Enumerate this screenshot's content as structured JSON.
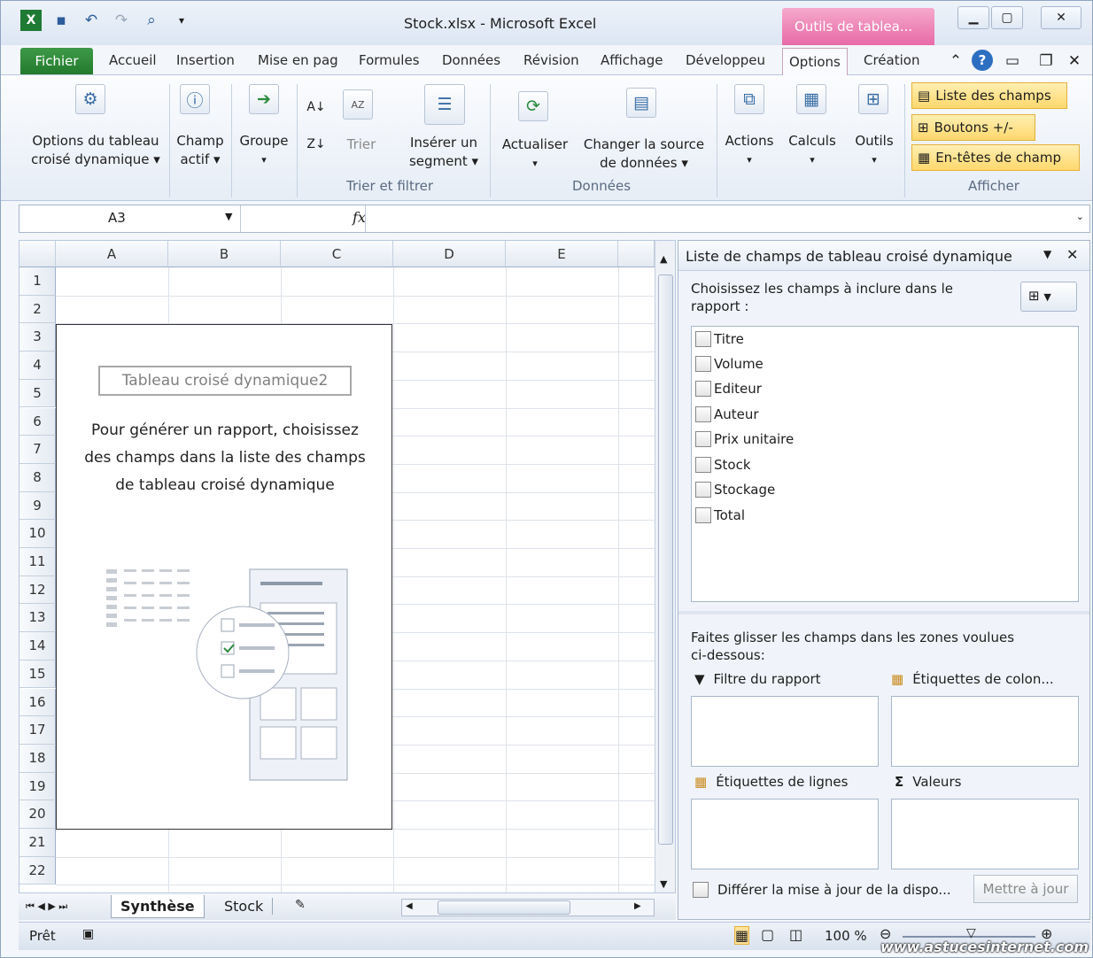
{
  "app": {
    "title": "Stock.xlsx - Microsoft Excel",
    "context_tab": "Outils de tablea...",
    "watermark": "www.astucesinternet.com"
  },
  "tabs": {
    "file": "Fichier",
    "items": [
      "Accueil",
      "Insertion",
      "Mise en pag",
      "Formules",
      "Données",
      "Révision",
      "Affichage",
      "Développeu",
      "Options",
      "Création"
    ],
    "active": "Options"
  },
  "ribbon": {
    "options_label1": "Options du tableau",
    "options_label2": "croisé dynamique ▾",
    "champ1": "Champ",
    "champ2": "actif ▾",
    "groupe": "Groupe",
    "groupe2": "▾",
    "trier": "Trier",
    "segment1": "Insérer un",
    "segment2": "segment ▾",
    "actualiser": "Actualiser",
    "actualiser2": "▾",
    "source1": "Changer la source",
    "source2": "de données ▾",
    "actions": "Actions",
    "actions2": "▾",
    "calculs": "Calculs",
    "calculs2": "▾",
    "outils": "Outils",
    "outils2": "▾",
    "liste_champs": "Liste des champs",
    "boutons": "Boutons +/-",
    "entetes": "En-têtes de champ",
    "group_trier": "Trier et filtrer",
    "group_donnees": "Données",
    "group_afficher": "Afficher"
  },
  "formula": {
    "namebox": "A3",
    "fx": "fx"
  },
  "grid": {
    "columns": [
      "A",
      "B",
      "C",
      "D",
      "E"
    ],
    "rows": [
      "1",
      "2",
      "3",
      "4",
      "5",
      "6",
      "7",
      "8",
      "9",
      "10",
      "11",
      "12",
      "13",
      "14",
      "15",
      "16",
      "17",
      "18",
      "19",
      "20",
      "21",
      "22"
    ]
  },
  "pivot": {
    "title": "Tableau croisé dynamique2",
    "line1": "Pour générer un rapport, choisissez",
    "line2": "des champs dans la liste des champs",
    "line3": "de tableau croisé dynamique"
  },
  "sheets": {
    "active": "Synthèse",
    "other": "Stock"
  },
  "status": {
    "ready": "Prêt",
    "zoom": "100 %"
  },
  "fieldlist": {
    "title": "Liste de champs de tableau croisé dynamique",
    "choose1": "Choisissez les champs à inclure dans le",
    "choose2": "rapport :",
    "fields": [
      "Titre",
      "Volume",
      "Editeur",
      "Auteur",
      "Prix unitaire",
      "Stock",
      "Stockage",
      "Total"
    ],
    "drag1": "Faites glisser les champs dans les zones voulues",
    "drag2": "ci-dessous:",
    "filtre": "Filtre du rapport",
    "colonnes": "Étiquettes de colon...",
    "lignes": "Étiquettes de lignes",
    "valeurs": "Valeurs",
    "defer": "Différer la mise à jour de la dispo...",
    "update": "Mettre à jour"
  }
}
